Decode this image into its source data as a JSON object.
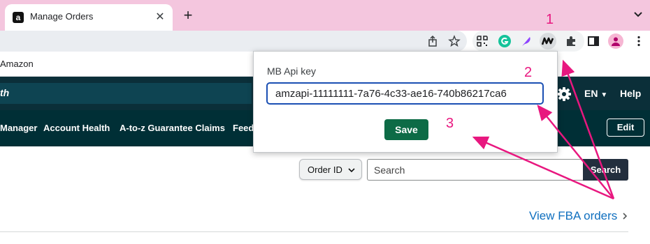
{
  "browser": {
    "tab": {
      "title": "Manage Orders",
      "favicon": "amazon-icon"
    },
    "new_tab_icon": "plus-icon",
    "tab_menu_icon": "chevron-down-icon",
    "toolbar_icons": [
      "share-icon",
      "star-icon",
      "qr-extension-icon",
      "grammarly-icon",
      "feather-extension-icon",
      "mb-extension-icon",
      "puzzle-icon",
      "sidepanel-icon",
      "profile-avatar-icon",
      "kebab-menu-icon"
    ]
  },
  "bookmarks": {
    "item": "Amazon"
  },
  "seller_header": {
    "search_text": "th",
    "lang": "EN",
    "help": "Help"
  },
  "nav": {
    "items": [
      "Manager",
      "Account Health",
      "A-to-z Guarantee Claims",
      "Feedb"
    ],
    "edit": "Edit"
  },
  "orders": {
    "filter_value": "Order ID",
    "search_placeholder": "Search",
    "search_button": "Search",
    "fba_link": "View FBA orders"
  },
  "popup": {
    "label": "MB Api key",
    "api_key": "amzapi-11111111-7a76-4c33-ae16-740b86217ca6",
    "save": "Save"
  },
  "annotations": {
    "marker1": "1",
    "marker2": "2",
    "marker3": "3",
    "color": "#e8177f"
  },
  "colors": {
    "tabstrip": "#f4c6de",
    "header_dark": "#0b2f39",
    "nav_dark": "#002f36",
    "save_green": "#0d6b46",
    "link_blue": "#0f6fbf"
  }
}
